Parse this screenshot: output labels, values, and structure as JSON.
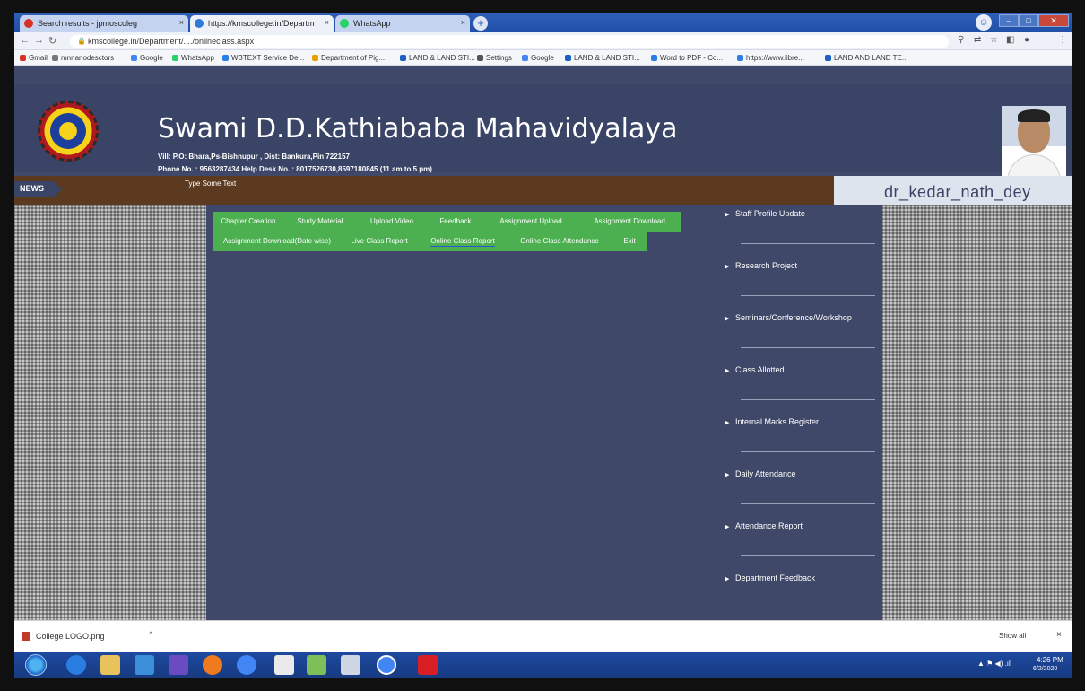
{
  "browser": {
    "tabs": [
      {
        "label": "Search results - jpmoscoleg",
        "close": "×"
      },
      {
        "label": "https://kmscollege.in/Departm",
        "close": "×"
      },
      {
        "label": "WhatsApp",
        "close": "×"
      }
    ],
    "new_tab": "+",
    "url": "kmscollege.in/Department/..../onlineclass.aspx",
    "bookmarks": [
      "Gmail",
      "mnnanodesctors",
      "Google",
      "WhatsApp",
      "WBTEXT Service De...",
      "Department of Pig...",
      "LAND & LAND STI...",
      "Settings",
      "Google",
      "LAND & LAND STI...",
      "Word to PDF - Co...",
      "https://www.libre...",
      "LAND AND LAND TE..."
    ]
  },
  "header": {
    "title": "Swami D.D.Kathiababa Mahavidyalaya",
    "address": "Vill: P.O: Bhara,Ps-Bishnupur , Dist: Bankura,Pin 722157",
    "phone": "Phone No. : 9563287434     Help Desk No. : 8017526730,8597180845 (11 am to 5 pm)"
  },
  "news": {
    "label": "NEWS",
    "text": "Type Some Text"
  },
  "user": {
    "name": "dr_kedar_nath_dey"
  },
  "menu": {
    "row1": [
      "Chapter Creation",
      "Study Material",
      "Upload Video",
      "Feedback",
      "Assignment Upload",
      "Assignment Download"
    ],
    "row2": [
      "Assignment Download(Date wise)",
      "Live Class Report",
      "Online Class Report",
      "Online Class Attendance",
      "Exit"
    ]
  },
  "sidebar": {
    "items": [
      "Staff Profile Update",
      "Research Project",
      "Seminars/Conference/Workshop",
      "Class Allotted",
      "Internal Marks Register",
      "Daily Attendance",
      "Attendance Report",
      "Department Feedback"
    ]
  },
  "downloads": {
    "file": "College LOGO.png",
    "caret": "^",
    "show_all": "Show all",
    "close": "×"
  },
  "taskbar": {
    "tray": "▲  ⚑  ◀)  .ıl",
    "time": "4:26 PM",
    "date": "6/2/2020"
  },
  "colors": {
    "page_bg": "#3f4868",
    "menu_green": "#4caf50",
    "news_brown": "#5c3a1f"
  }
}
